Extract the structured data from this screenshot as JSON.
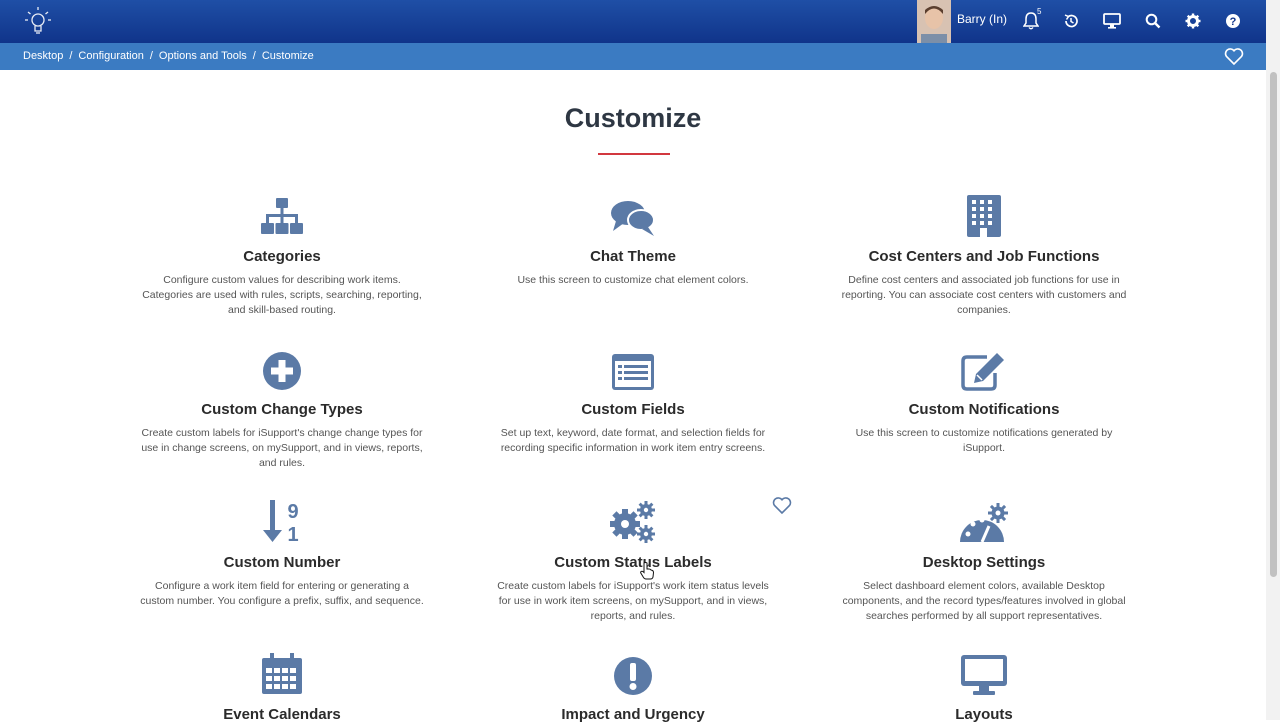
{
  "header": {
    "user_name": "Barry (In)",
    "notification_count": "5",
    "icons": [
      "lightbulb-logo-icon",
      "bell-icon",
      "history-icon",
      "monitor-icon",
      "search-icon",
      "gear-icon",
      "help-icon"
    ]
  },
  "breadcrumb": {
    "items": [
      "Desktop",
      "Configuration",
      "Options and Tools",
      "Customize"
    ],
    "separator": "/"
  },
  "page": {
    "title": "Customize"
  },
  "tiles": [
    {
      "icon": "sitemap-icon",
      "title": "Categories",
      "description": "Configure custom values for describing work items. Categories are used with rules, scripts, searching, reporting, and skill-based routing."
    },
    {
      "icon": "chat-bubbles-icon",
      "title": "Chat Theme",
      "description": "Use this screen to customize chat element colors."
    },
    {
      "icon": "building-icon",
      "title": "Cost Centers and Job Functions",
      "description": "Define cost centers and associated job functions for use in reporting. You can associate cost centers with customers and companies."
    },
    {
      "icon": "plus-circle-icon",
      "title": "Custom Change Types",
      "description": "Create custom labels for iSupport's change change types for use in change screens, on mySupport, and in views, reports, and rules."
    },
    {
      "icon": "list-form-icon",
      "title": "Custom Fields",
      "description": "Set up text, keyword, date format, and selection fields for recording specific information in work item entry screens."
    },
    {
      "icon": "edit-note-icon",
      "title": "Custom Notifications",
      "description": "Use this screen to customize notifications generated by iSupport."
    },
    {
      "icon": "sort-numeric-icon",
      "title": "Custom Number",
      "description": "Configure a work item field for entering or generating a custom number. You configure a prefix, suffix, and sequence."
    },
    {
      "icon": "gears-icon",
      "title": "Custom Status Labels",
      "description": "Create custom labels for iSupport's work item status levels for use in work item screens, on mySupport, and in views, reports, and rules."
    },
    {
      "icon": "dashboard-gear-icon",
      "title": "Desktop Settings",
      "description": "Select dashboard element colors, available Desktop components, and the record types/features involved in global searches performed by all support representatives."
    },
    {
      "icon": "calendar-icon",
      "title": "Event Calendars",
      "description": ""
    },
    {
      "icon": "exclamation-circle-icon",
      "title": "Impact and Urgency",
      "description": ""
    },
    {
      "icon": "monitor-icon",
      "title": "Layouts",
      "description": ""
    }
  ],
  "colors": {
    "header_bg": "#10348a",
    "breadcrumb_bg": "#3b7bc2",
    "icon": "#5b7aa6",
    "accent_rule": "#d2383f"
  }
}
